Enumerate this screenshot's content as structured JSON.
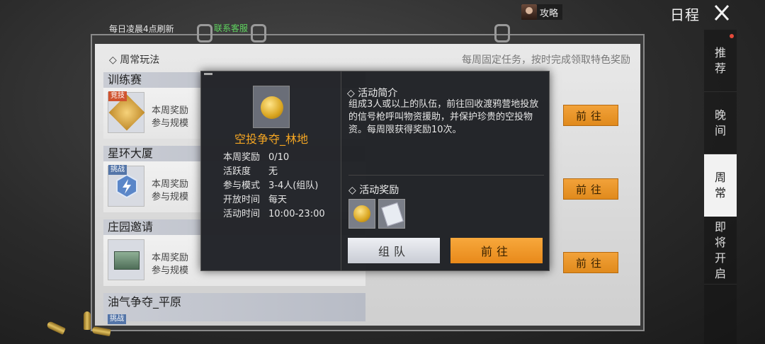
{
  "header": {
    "title": "日程",
    "guide_label": "攻略",
    "close_icon": "close-icon"
  },
  "board": {
    "refresh_note": "每日凌晨4点刷新",
    "support_link": "联系客服",
    "section_title": "◇ 周常玩法",
    "section_note": "每周固定任务，按时完成领取特色奖励"
  },
  "side_tabs": [
    {
      "label": [
        "推",
        "荐"
      ]
    },
    {
      "label": [
        "晚",
        "间"
      ]
    },
    {
      "label": [
        "周",
        "常"
      ]
    },
    {
      "label": [
        "即",
        "将",
        "开",
        "启"
      ]
    }
  ],
  "activities": [
    {
      "name": "训练赛",
      "badge": "竞技",
      "line1": "本周奖励",
      "line2": "参与规模"
    },
    {
      "name": "星环大厦",
      "badge": "挑战",
      "line1": "本周奖励",
      "line2": "参与规模"
    },
    {
      "name": "庄园邀请",
      "badge": "",
      "line1": "本周奖励",
      "line2": "参与规模"
    },
    {
      "name": "油气争夺_平原",
      "badge": "挑战",
      "line1": "",
      "line2": ""
    }
  ],
  "go_label": "前往",
  "popup": {
    "title": "空投争夺_林地",
    "info": [
      {
        "k": "本周奖励",
        "v": "0/10"
      },
      {
        "k": "活跃度",
        "v": "无"
      },
      {
        "k": "参与模式",
        "v": "3-4人(组队)"
      },
      {
        "k": "开放时间",
        "v": "每天"
      },
      {
        "k": "活动时间",
        "v": "10:00-23:00"
      }
    ],
    "desc_head": "◇ 活动简介",
    "desc_text": "组成3人或以上的队伍，前往回收渡鸦营地投放的信号枪呼叫物资援助，并保护珍贵的空投物资。每周限获得奖励10次。",
    "reward_head": "◇ 活动奖励",
    "team_label": "组队",
    "go_label": "前往"
  }
}
